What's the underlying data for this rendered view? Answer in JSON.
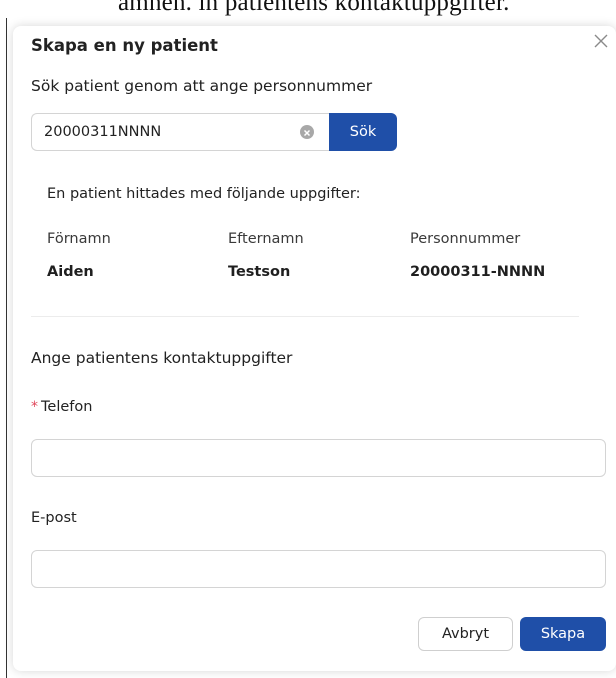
{
  "background_text": "ämnen. in patientens kontaktuppgifter.",
  "dialog": {
    "title": "Skapa en ny patient",
    "close_icon": "close-icon"
  },
  "search": {
    "label": "Sök patient genom att ange personnummer",
    "value": "20000311NNNN",
    "button_label": "Sök",
    "clear_icon": "clear-circle-icon"
  },
  "result": {
    "message": "En patient hittades med följande uppgifter:",
    "headers": [
      "Förnamn",
      "Efternamn",
      "Personnummer"
    ],
    "values": [
      "Aiden",
      "Testson",
      "20000311-NNNN"
    ]
  },
  "contact": {
    "heading": "Ange patientens kontaktuppgifter",
    "phone": {
      "required_marker": "*",
      "label": "Telefon",
      "value": ""
    },
    "email": {
      "label": "E-post",
      "value": ""
    }
  },
  "actions": {
    "cancel_label": "Avbryt",
    "create_label": "Skapa"
  },
  "colors": {
    "primary": "#1f4fa8",
    "required": "#e0475b",
    "border": "#d4d4d4"
  }
}
